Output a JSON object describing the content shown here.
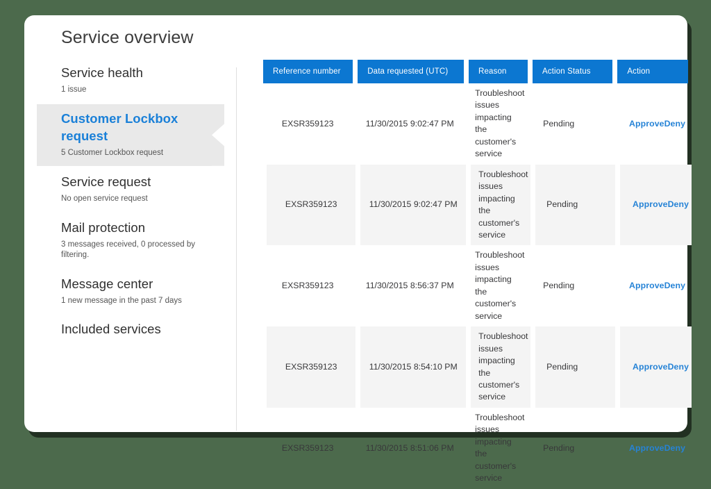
{
  "window": {
    "background_color": "#4c6a4c",
    "card_color": "#ffffff"
  },
  "header": {
    "title": "Service overview"
  },
  "theme": {
    "accent": "#0c77d1",
    "link": "#2683d6",
    "selected_row_bg": "#e9e9e9",
    "shaded_row_bg": "#f4f4f4"
  },
  "sidebar": {
    "items": [
      {
        "title": "Service health",
        "subtitle": "1 issue",
        "selected": false
      },
      {
        "title": "Customer Lockbox request",
        "subtitle": "5 Customer Lockbox request",
        "selected": true
      },
      {
        "title": "Service request",
        "subtitle": "No open service request",
        "selected": false
      },
      {
        "title": "Mail protection",
        "subtitle": "3 messages received, 0 processed by filtering.",
        "selected": false
      },
      {
        "title": "Message center",
        "subtitle": "1 new message in the past 7 days",
        "selected": false
      },
      {
        "title": "Included services",
        "subtitle": "",
        "selected": false
      }
    ]
  },
  "table": {
    "columns": [
      "Reference number",
      "Data requested (UTC)",
      "Reason",
      "Action Status",
      "Action"
    ],
    "action_labels": {
      "approve": "Approve",
      "deny": "Deny"
    },
    "rows": [
      {
        "reference": "EXSR359123",
        "requested": "11/30/2015 9:02:47 PM",
        "reason": "Troubleshoot issues impacting the customer's service",
        "status": "Pending",
        "approve": "Approve",
        "deny": "Deny",
        "shaded": false
      },
      {
        "reference": "EXSR359123",
        "requested": "11/30/2015 9:02:47 PM",
        "reason": "Troubleshoot issues impacting the customer's service",
        "status": "Pending",
        "approve": "Approve",
        "deny": "Deny",
        "shaded": true
      },
      {
        "reference": "EXSR359123",
        "requested": "11/30/2015 8:56:37 PM",
        "reason": "Troubleshoot issues impacting the customer's service",
        "status": "Pending",
        "approve": "Approve",
        "deny": "Deny",
        "shaded": false
      },
      {
        "reference": "EXSR359123",
        "requested": "11/30/2015 8:54:10 PM",
        "reason": "Troubleshoot issues impacting the customer's service",
        "status": "Pending",
        "approve": "Approve",
        "deny": "Deny",
        "shaded": true
      },
      {
        "reference": "EXSR359123",
        "requested": "11/30/2015 8:51:06 PM",
        "reason": "Troubleshoot issues impacting the customer's service",
        "status": "Pending",
        "approve": "Approve",
        "deny": "Deny",
        "shaded": false
      }
    ]
  }
}
